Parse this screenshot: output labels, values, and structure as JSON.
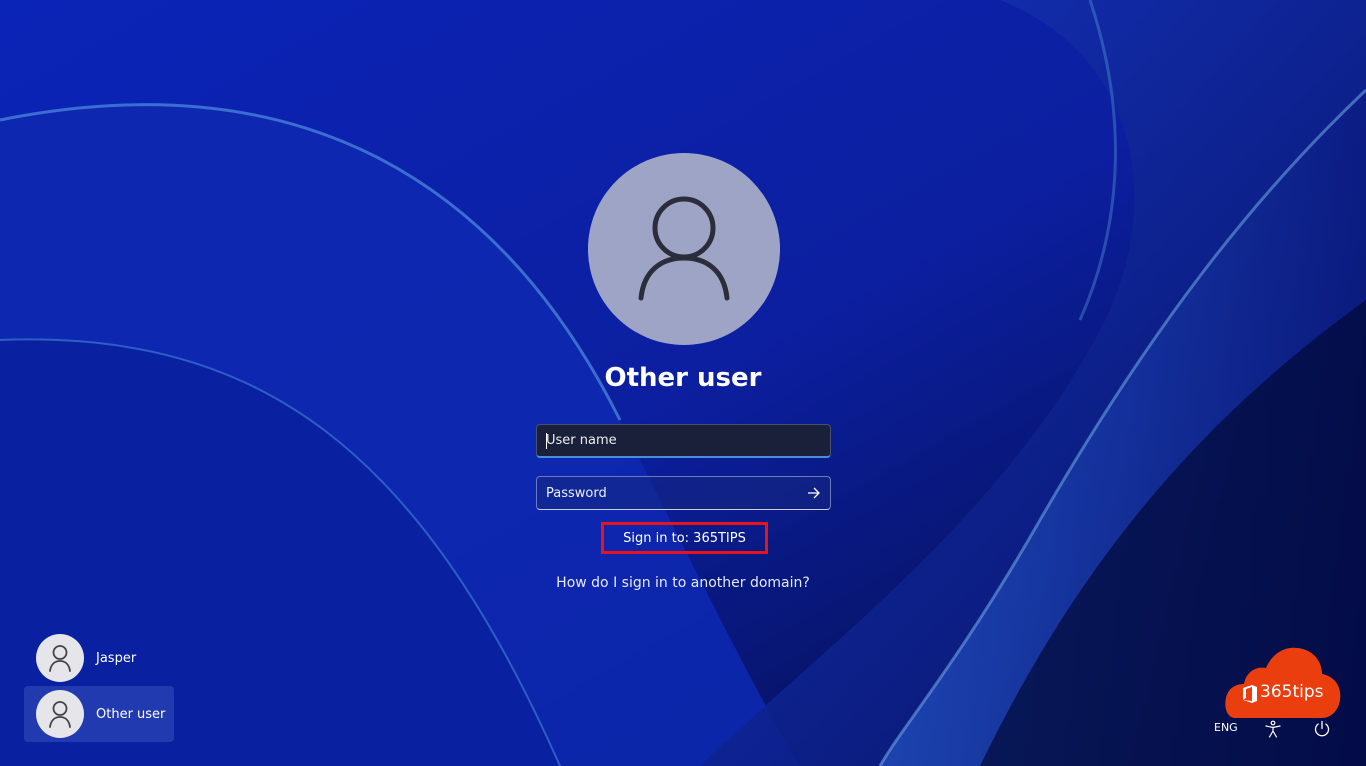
{
  "login": {
    "title": "Other user",
    "username_placeholder": "User name",
    "password_placeholder": "Password",
    "signin_to": "Sign in to: 365TIPS",
    "help_link": "How do I sign in to another domain?"
  },
  "users": [
    {
      "name": "Jasper",
      "selected": false
    },
    {
      "name": "Other user",
      "selected": true
    }
  ],
  "logo": {
    "text": "365tips"
  },
  "tray": {
    "language": "ENG"
  },
  "icons": {
    "avatar": "person-icon",
    "submit": "arrow-right-icon",
    "accessibility": "accessibility-icon",
    "power": "power-icon",
    "logo_cloud": "cloud-icon",
    "logo_office": "office-icon"
  },
  "colors": {
    "background": "#0a1fa8",
    "highlight_box": "#e8141c",
    "logo_cloud": "#ea3e0f",
    "field_focus": "#4a8ed8"
  }
}
